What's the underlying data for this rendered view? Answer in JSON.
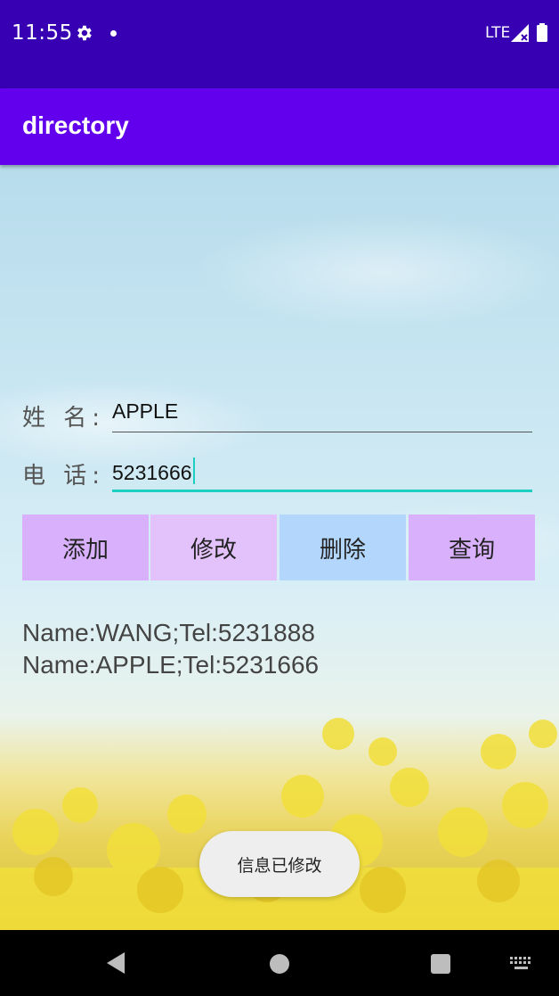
{
  "status_bar": {
    "time": "11:55",
    "network": "LTE",
    "icons": [
      "gear-icon",
      "dot-icon",
      "signal-icon",
      "battery-icon"
    ]
  },
  "app_bar": {
    "title": "directory"
  },
  "form": {
    "name_label": "姓 名:",
    "name_value": "APPLE",
    "phone_label": "电 话:",
    "phone_value": "5231666"
  },
  "buttons": {
    "add": "添加",
    "edit": "修改",
    "delete": "删除",
    "query": "查询"
  },
  "colors": {
    "status_bar": "#3700b3",
    "app_bar": "#6200ee",
    "add_button": "#d9b0fb",
    "edit_button": "#e3c2fb",
    "delete_button": "#b3d7fc",
    "query_button": "#d9b0fb",
    "focus_line": "#1ccfc0"
  },
  "results": [
    "Name:WANG;Tel:5231888",
    "Name:APPLE;Tel:5231666"
  ],
  "toast": "信息已修改",
  "nav_bar": {
    "icons": [
      "back-icon",
      "home-icon",
      "recents-icon",
      "keyboard-icon"
    ]
  }
}
